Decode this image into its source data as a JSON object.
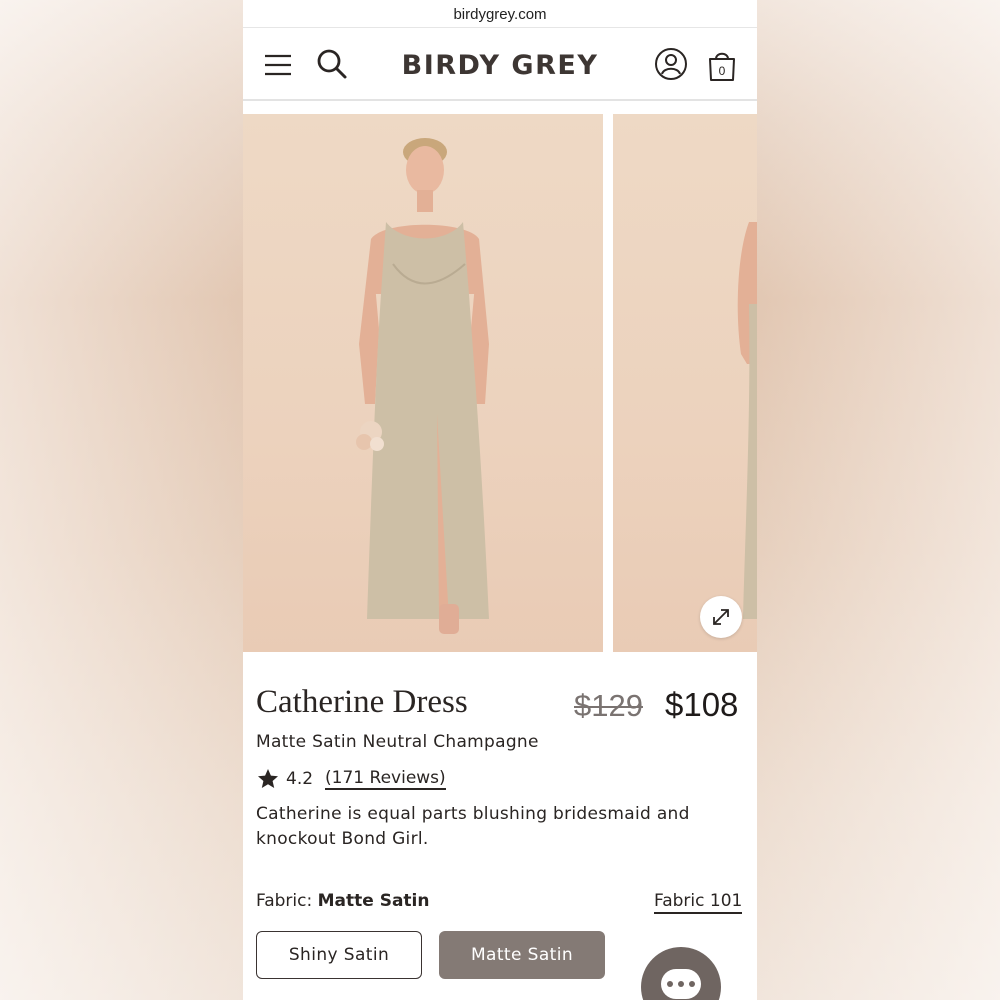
{
  "browser": {
    "url": "birdygrey.com"
  },
  "header": {
    "logo": "BIRDY GREY",
    "bag_count": "0"
  },
  "product": {
    "name": "Catherine Dress",
    "price_original": "$129",
    "price_sale": "$108",
    "variant": "Matte Satin Neutral Champagne",
    "rating": "4.2",
    "reviews_label": "(171 Reviews)",
    "description": "Catherine is equal parts blushing bridesmaid and knockout Bond Girl."
  },
  "fabric": {
    "label_prefix": "Fabric:",
    "selected": "Matte Satin",
    "link": "Fabric 101",
    "options": [
      {
        "label": "Shiny Satin",
        "selected": false
      },
      {
        "label": "Matte Satin",
        "selected": true
      }
    ]
  },
  "colors": {
    "accent": "#847a75",
    "text": "#2a2523",
    "photo_bg": "#ecd2bd",
    "dress": "#cdbfa6"
  },
  "icons": [
    "menu-icon",
    "search-icon",
    "account-icon",
    "shopping-bag-icon",
    "expand-icon",
    "star-icon",
    "chat-icon"
  ]
}
